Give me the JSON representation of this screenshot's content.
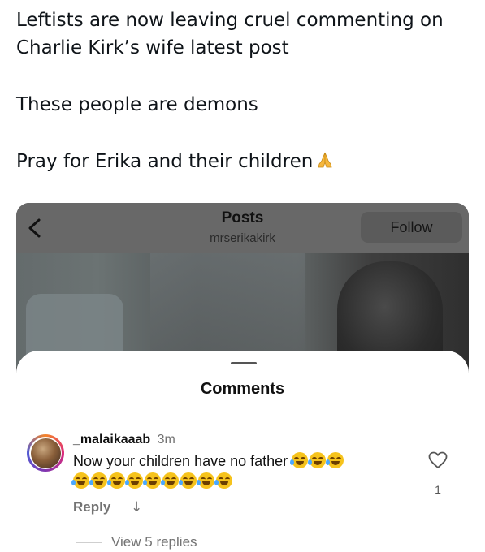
{
  "tweet": {
    "line1": "Leftists are now leaving cruel commenting on",
    "line2": "Charlie Kirk’s wife latest post",
    "line3": "These people are demons",
    "line4": "Pray for Erika and their children",
    "line4_emoji": "folded-hands-emoji"
  },
  "instagram": {
    "header": {
      "title": "Posts",
      "subtitle": "mrserikakirk",
      "follow_label": "Follow"
    },
    "comments_sheet": {
      "title": "Comments",
      "comment": {
        "username": "_malaikaaab",
        "time": "3m",
        "text": "Now your children have no father",
        "emoji_name": "face-with-tears-of-joy",
        "emoji_count_line1": 3,
        "emoji_count_line2": 9,
        "reply_label": "Reply",
        "reply_arrow": "↓",
        "like_count": "1"
      },
      "view_replies_label": "View 5 replies"
    }
  },
  "colors": {
    "sheet_bg": "#ffffff",
    "header_overlay": "#686868",
    "muted_text": "#737373"
  }
}
